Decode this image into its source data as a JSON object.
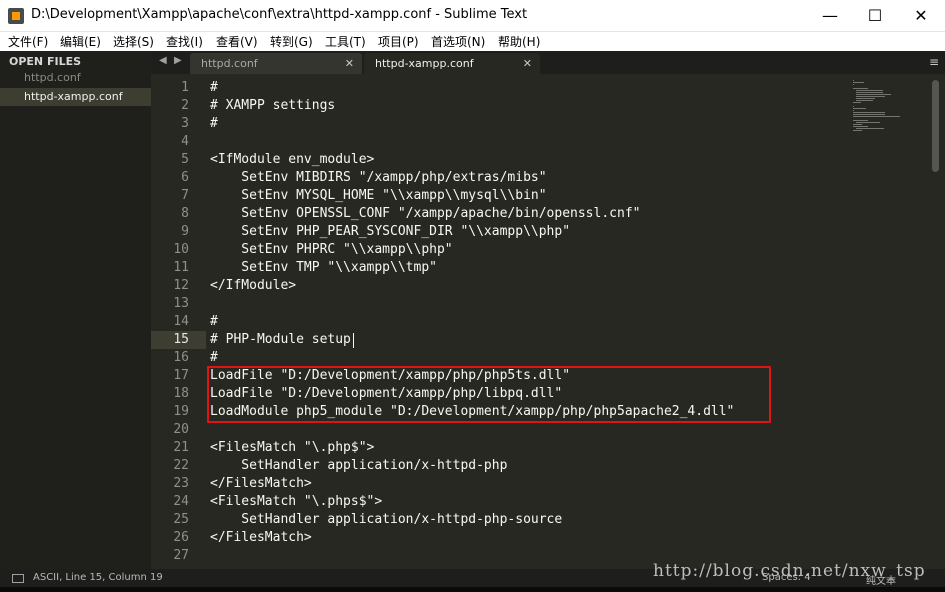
{
  "window": {
    "title": "D:\\Development\\Xampp\\apache\\conf\\extra\\httpd-xampp.conf - Sublime Text",
    "minimize_glyph": "—",
    "maximize_glyph": "☐",
    "close_glyph": "✕"
  },
  "menu": [
    "文件(F)",
    "编辑(E)",
    "选择(S)",
    "查找(I)",
    "查看(V)",
    "转到(G)",
    "工具(T)",
    "项目(P)",
    "首选项(N)",
    "帮助(H)"
  ],
  "sidebar": {
    "heading": "OPEN FILES",
    "files": [
      {
        "label": "httpd.conf",
        "active": false
      },
      {
        "label": "httpd-xampp.conf",
        "active": true
      }
    ]
  },
  "tabs": {
    "nav_left": "◀",
    "nav_right": "▶",
    "items": [
      {
        "label": "httpd.conf",
        "close": "✕",
        "active": false
      },
      {
        "label": "httpd-xampp.conf",
        "close": "✕",
        "active": true
      }
    ],
    "menu_glyph": "≡"
  },
  "editor": {
    "current_line": 15,
    "lines": [
      "#",
      "# XAMPP settings",
      "#",
      "",
      "<IfModule env_module>",
      "    SetEnv MIBDIRS \"/xampp/php/extras/mibs\"",
      "    SetEnv MYSQL_HOME \"\\\\xampp\\\\mysql\\\\bin\"",
      "    SetEnv OPENSSL_CONF \"/xampp/apache/bin/openssl.cnf\"",
      "    SetEnv PHP_PEAR_SYSCONF_DIR \"\\\\xampp\\\\php\"",
      "    SetEnv PHPRC \"\\\\xampp\\\\php\"",
      "    SetEnv TMP \"\\\\xampp\\\\tmp\"",
      "</IfModule>",
      "",
      "#",
      "# PHP-Module setup",
      "#",
      "LoadFile \"D:/Development/xampp/php/php5ts.dll\"",
      "LoadFile \"D:/Development/xampp/php/libpq.dll\"",
      "LoadModule php5_module \"D:/Development/xampp/php/php5apache2_4.dll\"",
      "",
      "<FilesMatch \"\\.php$\">",
      "    SetHandler application/x-httpd-php",
      "</FilesMatch>",
      "<FilesMatch \"\\.phps$\">",
      "    SetHandler application/x-httpd-php-source",
      "</FilesMatch>",
      ""
    ]
  },
  "status": {
    "text": "ASCII, Line 15, Column 19",
    "spaces": "Spaces: 4",
    "syntax": "纯文本"
  },
  "watermark": "http://blog.csdn.net/nxw_tsp",
  "colors": {
    "editor_bg": "#272822",
    "foreground": "#f8f8f2",
    "highlight_box": "#e01414"
  }
}
